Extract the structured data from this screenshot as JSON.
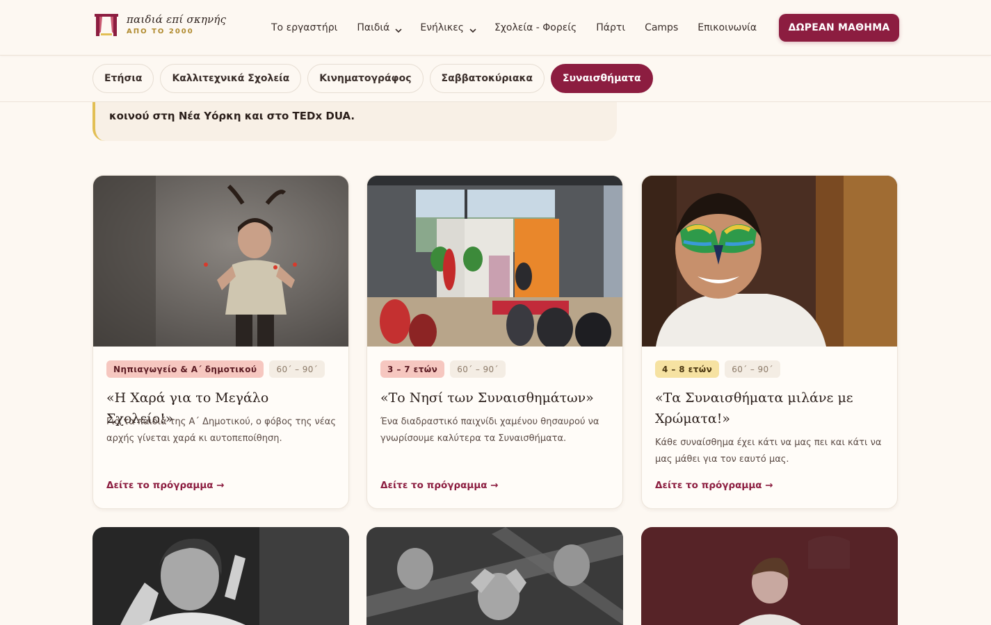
{
  "header": {
    "logo_title": "παιδιά επί σκηνής",
    "logo_sub": "ΑΠΟ ΤΟ 2000",
    "nav": [
      {
        "label": "Το εργαστήρι",
        "dropdown": false
      },
      {
        "label": "Παιδιά",
        "dropdown": true
      },
      {
        "label": "Ενήλικες",
        "dropdown": true
      },
      {
        "label": "Σχολεία - Φορείς",
        "dropdown": false
      },
      {
        "label": "Πάρτι",
        "dropdown": false
      },
      {
        "label": "Camps",
        "dropdown": false
      },
      {
        "label": "Επικοινωνία",
        "dropdown": false
      }
    ],
    "cta_label": "ΔΩΡΕΑΝ ΜΑΘΗΜΑ"
  },
  "filters": [
    {
      "label": "Ετήσια",
      "active": false
    },
    {
      "label": "Καλλιτεχνικά Σχολεία",
      "active": false
    },
    {
      "label": "Κινηματογράφος",
      "active": false
    },
    {
      "label": "Σαββατοκύριακα",
      "active": false
    },
    {
      "label": "Συναισθήματα",
      "active": true
    }
  ],
  "quote": {
    "text": "κοινού στη Νέα Υόρκη και στο TEDx DUA."
  },
  "cards": [
    {
      "age": "Νηπιαγωγείο & Α΄ δημοτικού",
      "duration": "60΄ – 90΄",
      "title": "«Η Χαρά για το Μεγάλο Σχολείο!»",
      "desc": "Για τα παιδιά της Α΄ Δημοτικού, ο φόβος της νέας αρχής γίνεται χαρά κι αυτοπεποίθηση.",
      "link": "Δείτε το πρόγραμμα →"
    },
    {
      "age": "3 – 7 ετών",
      "duration": "60΄ – 90΄",
      "title": "«Το Νησί των Συναισθημάτων»",
      "desc": "Ένα διαδραστικό παιχνίδι χαμένου θησαυρού να γνωρίσουμε καλύτερα τα Συναισθήματα.",
      "link": "Δείτε το πρόγραμμα →"
    },
    {
      "age": "4 – 8 ετών",
      "duration": "60΄ – 90΄",
      "title": "«Τα Συναισθήματα μιλάνε με Χρώματα!»",
      "desc": "Κάθε συναίσθημα έχει κάτι να μας πει και κάτι να μας μάθει για τον εαυτό μας.",
      "link": "Δείτε το πρόγραμμα →"
    }
  ],
  "colors": {
    "brand": "#8c1d40",
    "gold": "#b08a2e",
    "background": "#fdf8f2"
  }
}
